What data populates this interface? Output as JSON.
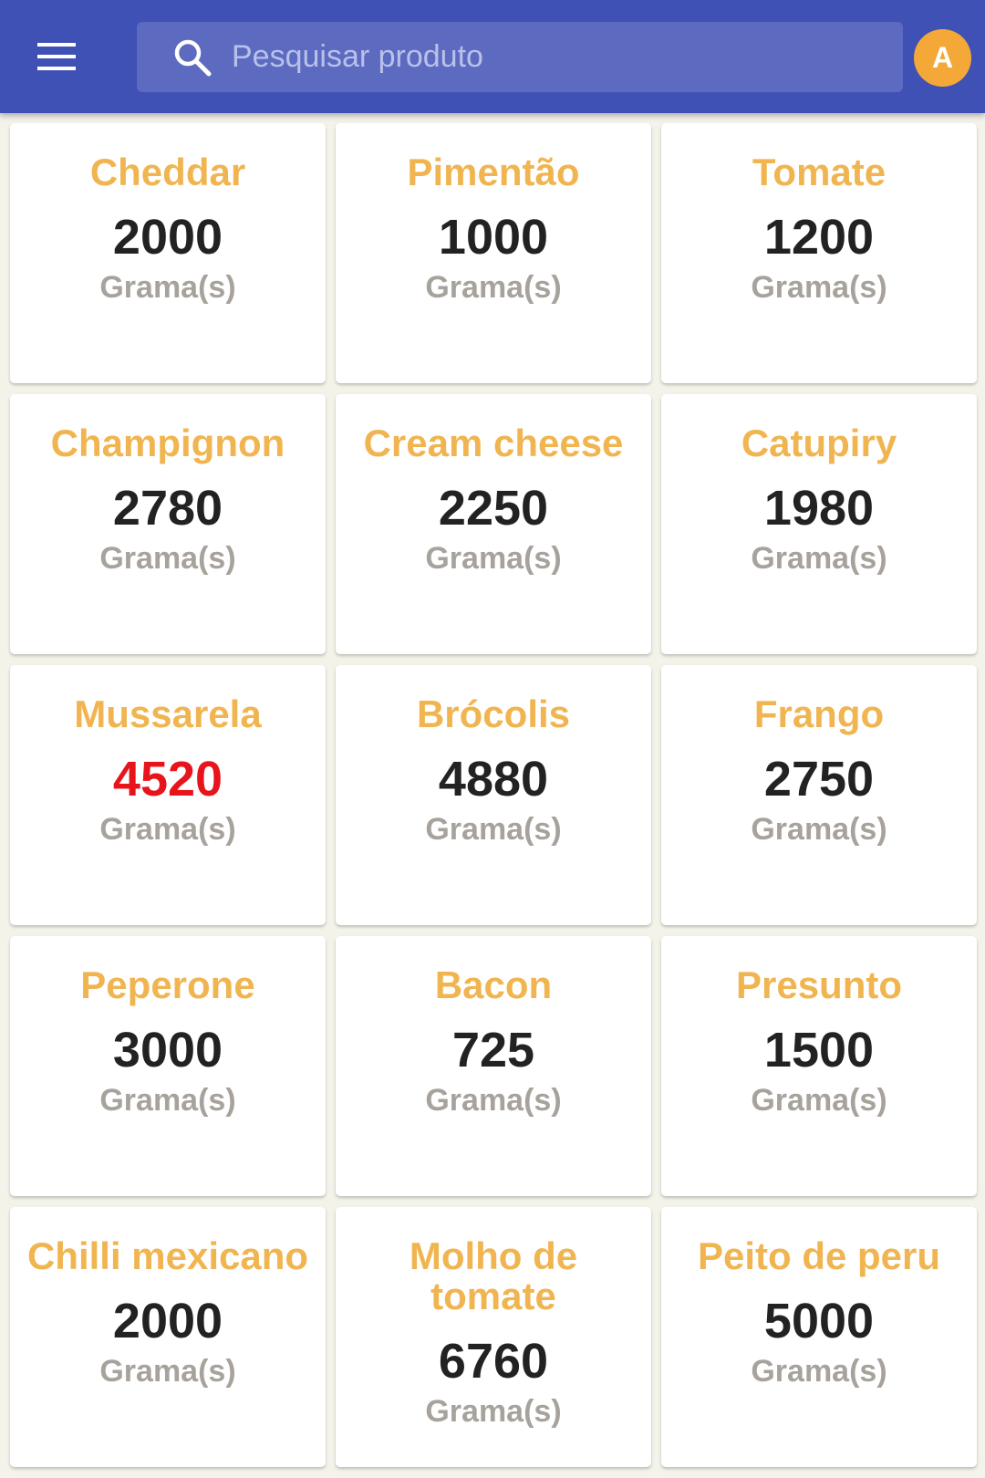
{
  "header": {
    "search_placeholder": "Pesquisar produto",
    "avatar_initial": "A",
    "menu_icon": "hamburger-menu-icon",
    "search_icon": "search-icon",
    "colors": {
      "appbar": "#3f51b5",
      "search_box": "#5c6bc0",
      "avatar": "#f3a838"
    }
  },
  "colors": {
    "product_name": "#f0b550",
    "quantity": "#222222",
    "quantity_alert": "#e8141c",
    "unit": "#a7a39c"
  },
  "products": [
    {
      "name": "Cheddar",
      "quantity": "2000",
      "unit": "Grama(s)",
      "alert": false
    },
    {
      "name": "Pimentão",
      "quantity": "1000",
      "unit": "Grama(s)",
      "alert": false
    },
    {
      "name": "Tomate",
      "quantity": "1200",
      "unit": "Grama(s)",
      "alert": false
    },
    {
      "name": "Champignon",
      "quantity": "2780",
      "unit": "Grama(s)",
      "alert": false
    },
    {
      "name": "Cream cheese",
      "quantity": "2250",
      "unit": "Grama(s)",
      "alert": false
    },
    {
      "name": "Catupiry",
      "quantity": "1980",
      "unit": "Grama(s)",
      "alert": false
    },
    {
      "name": "Mussarela",
      "quantity": "4520",
      "unit": "Grama(s)",
      "alert": true
    },
    {
      "name": "Brócolis",
      "quantity": "4880",
      "unit": "Grama(s)",
      "alert": false
    },
    {
      "name": "Frango",
      "quantity": "2750",
      "unit": "Grama(s)",
      "alert": false
    },
    {
      "name": "Peperone",
      "quantity": "3000",
      "unit": "Grama(s)",
      "alert": false
    },
    {
      "name": "Bacon",
      "quantity": "725",
      "unit": "Grama(s)",
      "alert": false
    },
    {
      "name": "Presunto",
      "quantity": "1500",
      "unit": "Grama(s)",
      "alert": false
    },
    {
      "name": "Chilli mexicano",
      "quantity": "2000",
      "unit": "Grama(s)",
      "alert": false
    },
    {
      "name": "Molho de tomate",
      "quantity": "6760",
      "unit": "Grama(s)",
      "alert": false
    },
    {
      "name": "Peito de peru",
      "quantity": "5000",
      "unit": "Grama(s)",
      "alert": false
    }
  ]
}
